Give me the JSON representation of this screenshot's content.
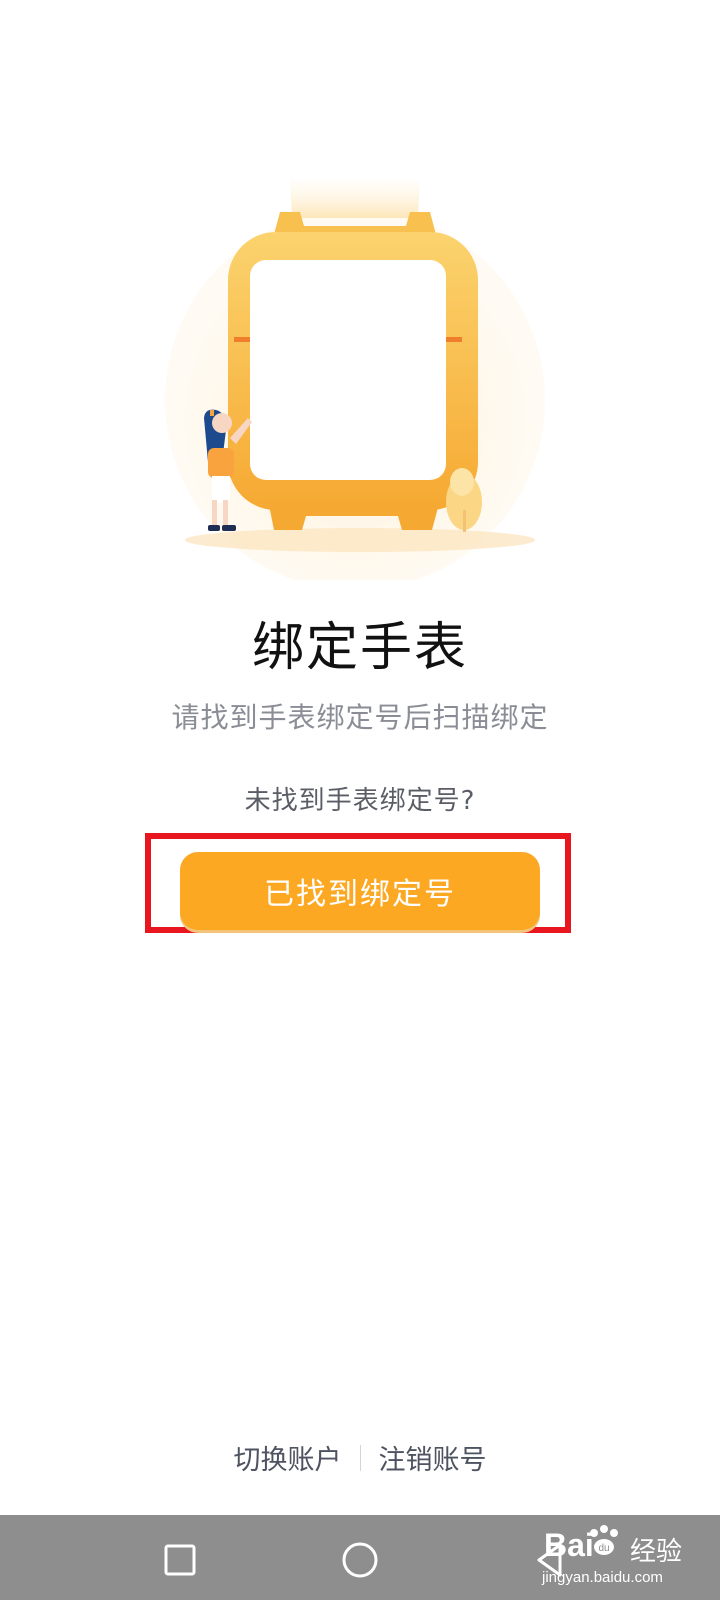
{
  "main": {
    "title": "绑定手表",
    "subtitle": "请找到手表绑定号后扫描绑定",
    "help_link": "未找到手表绑定号?",
    "primary_button_label": "已找到绑定号"
  },
  "footer": {
    "switch_account": "切换账户",
    "cancel_account": "注销账号"
  },
  "nav_bar": {
    "buttons": [
      "square-recents-icon",
      "circle-home-icon",
      "triangle-back-icon"
    ]
  },
  "watermark": {
    "brand": "Bai",
    "brand_suffix": "经验",
    "url": "jingyan.baidu.com"
  },
  "colors": {
    "accent": "#fca823",
    "highlight_frame": "#e8161f",
    "watch_body": "#f8ba3c",
    "nav_bar": "#8e8e8e"
  }
}
